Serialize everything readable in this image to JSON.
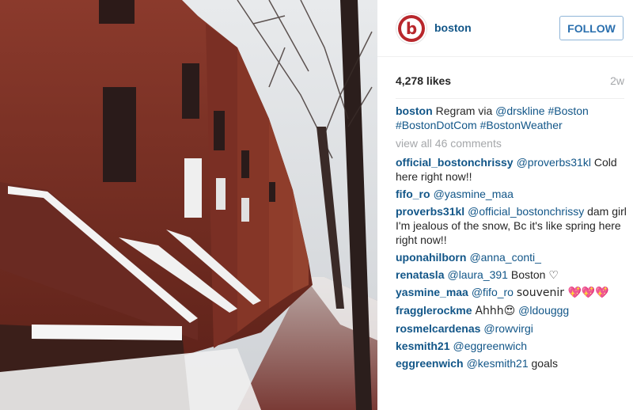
{
  "post": {
    "username": "boston",
    "follow_label": "FOLLOW",
    "likes": "4,278 likes",
    "age": "2w",
    "avatar_letter": "b"
  },
  "caption": {
    "user": "boston",
    "text": "Regram via ",
    "mention": "@drskline",
    "hashtags": "#Boston #BostonDotCom #BostonWeather"
  },
  "view_all_comments": "view all 46 comments",
  "comments": [
    {
      "user": "official_bostonchrissy",
      "mention": "@proverbs31kl",
      "text": "Cold here right now!!"
    },
    {
      "user": "fifo_ro",
      "mention": "@yasmine_maa",
      "text": ""
    },
    {
      "user": "proverbs31kl",
      "mention": "@official_bostonchrissy",
      "text": "dam girl I'm jealous of the snow, Bc it's like spring here right now!!"
    },
    {
      "user": "uponahilborn",
      "mention": "@anna_conti_",
      "text": ""
    },
    {
      "user": "renatasla",
      "mention": "@laura_391",
      "text": "Boston ♡"
    },
    {
      "user": "yasmine_maa",
      "mention": "@fifo_ro",
      "text": "souvenir 💖💖💖"
    },
    {
      "user": "fragglerockme",
      "mention": "@ldouggg",
      "text": "Ahhh😍"
    },
    {
      "user": "rosmelcardenas",
      "mention": "@rowvirgi",
      "text": ""
    },
    {
      "user": "kesmith21",
      "mention": "@eggreenwich",
      "text": ""
    },
    {
      "user": "eggreenwich",
      "mention": "@kesmith21",
      "text": "goals"
    }
  ],
  "colors": {
    "link": "#125688",
    "follow": "#2a6fae",
    "brand": "#b8272c",
    "muted": "#a5a7aa"
  }
}
